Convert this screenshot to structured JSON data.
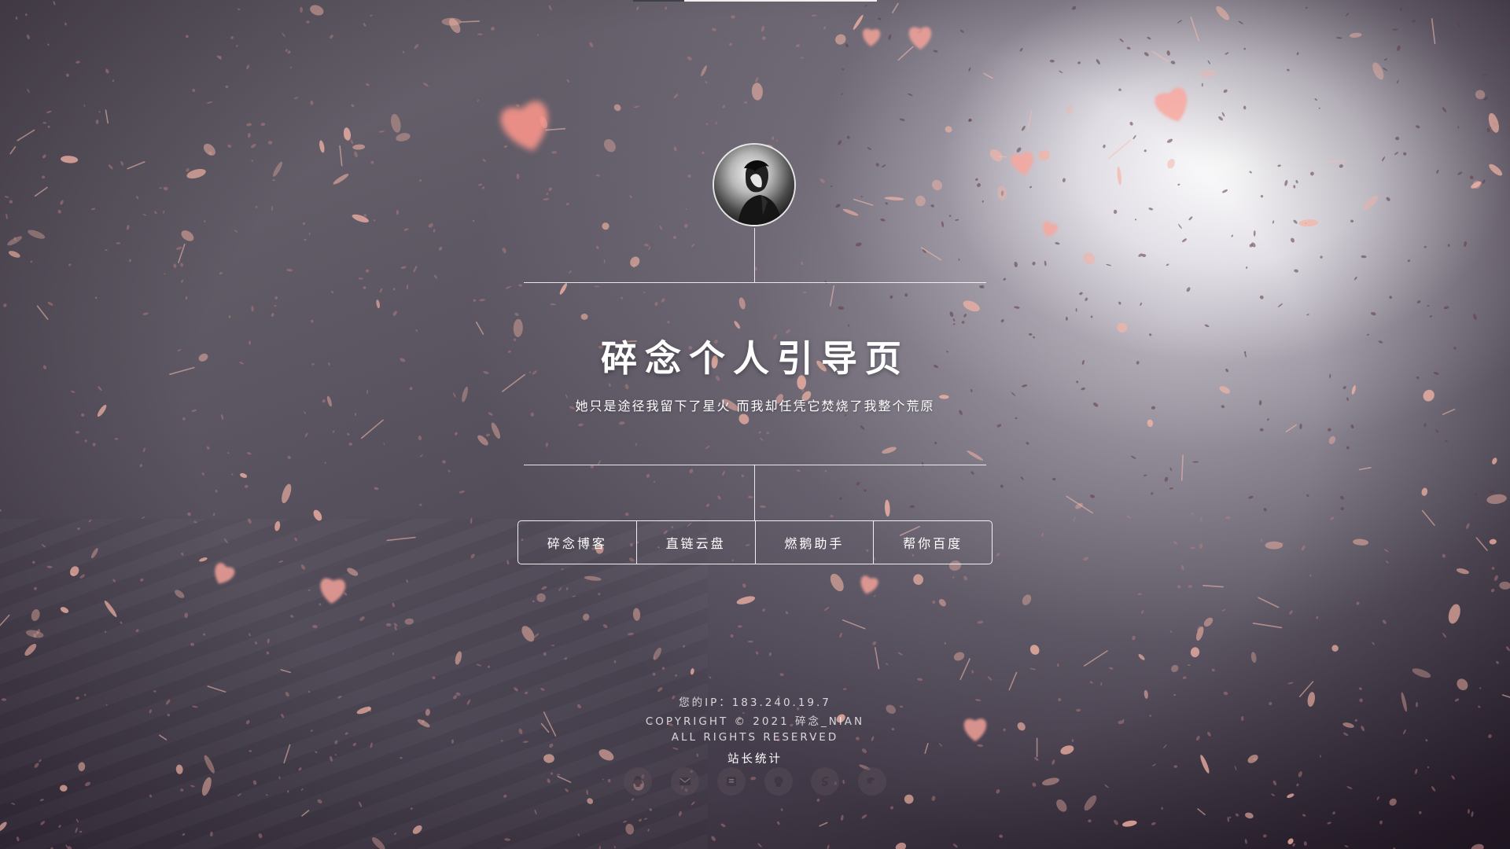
{
  "page": {
    "title": "碎念个人引导页",
    "subtitle": "她只是途径我留下了星火 而我却任凭它焚烧了我整个荒原"
  },
  "nav": {
    "items": [
      {
        "label": "碎念博客"
      },
      {
        "label": "直链云盘"
      },
      {
        "label": "燃鹅助手"
      },
      {
        "label": "帮你百度"
      }
    ]
  },
  "footer": {
    "ip_line": "您的IP：183.240.19.7",
    "copyright": "COPYRIGHT © 2021 碎念_NIAN",
    "rights": "ALL RIGHTS RESERVED",
    "stats_link": "站长统计"
  },
  "social": {
    "icons": [
      "qq-icon",
      "mail-icon",
      "blog-icon",
      "github-icon",
      "weibo-icon",
      "wechat-icon"
    ]
  },
  "colors": {
    "petal": "#f4a49a",
    "petal_glow": "#ff8d86",
    "line": "#ffffff",
    "text": "#ffffff"
  }
}
